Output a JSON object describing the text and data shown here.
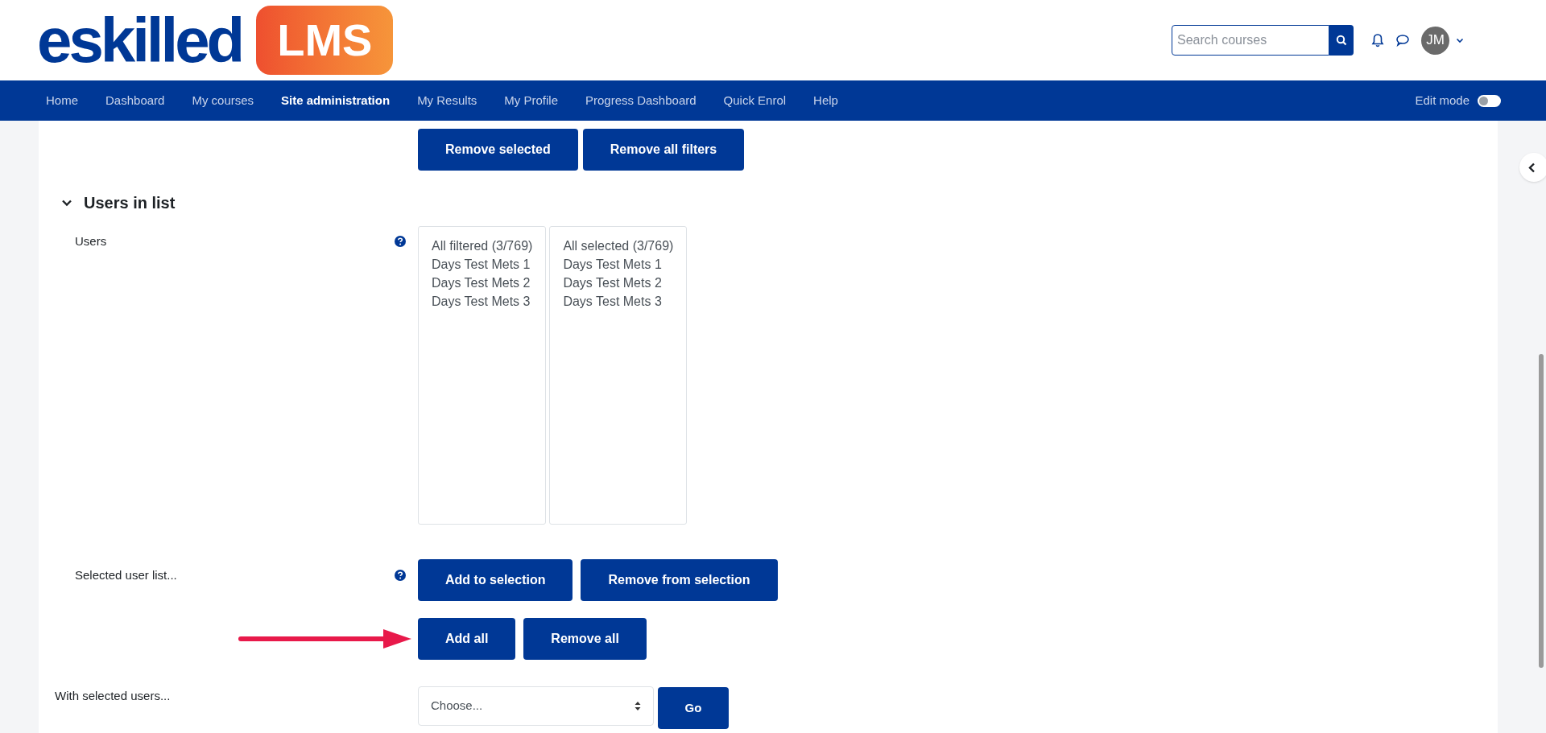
{
  "header": {
    "logo": {
      "wordmark": "eskilled",
      "badge": "LMS"
    },
    "search": {
      "placeholder": "Search courses"
    },
    "avatar": "JM"
  },
  "nav": {
    "items": [
      {
        "label": "Home",
        "selected": false
      },
      {
        "label": "Dashboard",
        "selected": false
      },
      {
        "label": "My courses",
        "selected": false
      },
      {
        "label": "Site administration",
        "selected": true
      },
      {
        "label": "My Results",
        "selected": false
      },
      {
        "label": "My Profile",
        "selected": false
      },
      {
        "label": "Progress Dashboard",
        "selected": false
      },
      {
        "label": "Quick Enrol",
        "selected": false
      },
      {
        "label": "Help",
        "selected": false
      }
    ],
    "edit_mode": {
      "label": "Edit mode",
      "on": false
    }
  },
  "filter_buttons": [
    "Remove selected",
    "Remove all filters"
  ],
  "section": {
    "title": "Users in list",
    "expanded": true
  },
  "users": {
    "label": "Users",
    "lists": [
      {
        "options": [
          "All filtered (3/769)",
          "Days Test Mets 1",
          "Days Test Mets 2",
          "Days Test Mets 3"
        ]
      },
      {
        "options": [
          "All selected (3/769)",
          "Days Test Mets 1",
          "Days Test Mets 2",
          "Days Test Mets 3"
        ]
      }
    ]
  },
  "selected_list": {
    "label": "Selected user list...",
    "button_rows": [
      [
        "Add to selection",
        "Remove from selection"
      ],
      [
        "Add all",
        "Remove all"
      ]
    ]
  },
  "bulk_action": {
    "label": "With selected users...",
    "select": "Choose...",
    "button": "Go"
  }
}
